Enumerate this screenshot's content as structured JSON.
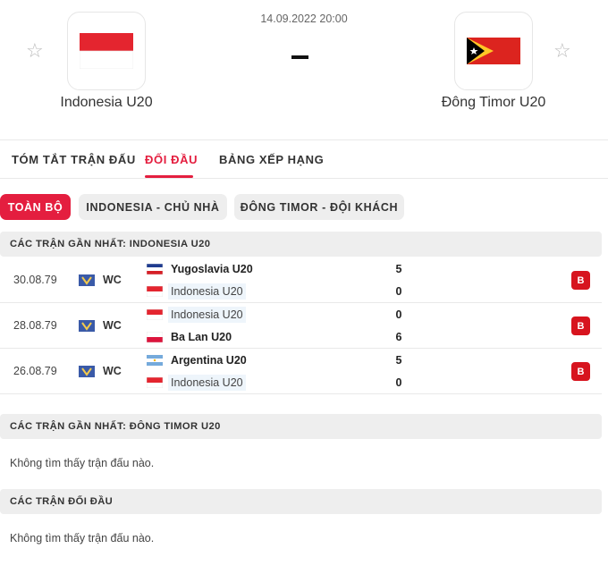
{
  "header": {
    "datetime": "14.09.2022 20:00",
    "home_team": {
      "name": "Indonesia U20",
      "flag": "indonesia-flag"
    },
    "away_team": {
      "name": "Đông Timor U20",
      "flag": "east-timor-flag"
    },
    "score_separator": "-"
  },
  "tabs": [
    {
      "label": "TÓM TẮT TRẬN ĐẤU",
      "active": false
    },
    {
      "label": "ĐỐI ĐẦU",
      "active": true
    },
    {
      "label": "BẢNG XẾP HẠNG",
      "active": false
    }
  ],
  "filters": [
    {
      "label": "TOÀN BỘ",
      "active": true
    },
    {
      "label": "INDONESIA - CHỦ NHÀ",
      "active": false
    },
    {
      "label": "ĐÔNG TIMOR - ĐỘI KHÁCH",
      "active": false
    }
  ],
  "sections": {
    "home_recent": {
      "title": "CÁC TRẬN GẦN NHẤT: INDONESIA U20",
      "matches": [
        {
          "date": "30.08.79",
          "competition": "WC",
          "team1": {
            "name": "Yugoslavia U20",
            "flag": "yugoslavia-flag",
            "score": "5"
          },
          "team2": {
            "name": "Indonesia U20",
            "flag": "indonesia-flag",
            "score": "0"
          },
          "result": "B"
        },
        {
          "date": "28.08.79",
          "competition": "WC",
          "team1": {
            "name": "Indonesia U20",
            "flag": "indonesia-flag",
            "score": "0"
          },
          "team2": {
            "name": "Ba Lan U20",
            "flag": "poland-flag",
            "score": "6"
          },
          "result": "B"
        },
        {
          "date": "26.08.79",
          "competition": "WC",
          "team1": {
            "name": "Argentina U20",
            "flag": "argentina-flag",
            "score": "5"
          },
          "team2": {
            "name": "Indonesia U20",
            "flag": "indonesia-flag",
            "score": "0"
          },
          "result": "B"
        }
      ]
    },
    "away_recent": {
      "title": "CÁC TRẬN GẦN NHẤT: ĐÔNG TIMOR U20",
      "empty_text": "Không tìm thấy trận đấu nào."
    },
    "head_to_head": {
      "title": "CÁC TRẬN ĐỐI ĐẦU",
      "empty_text": "Không tìm thấy trận đấu nào."
    }
  },
  "colors": {
    "accent": "#e41e3f",
    "loss_badge": "#d7141e",
    "section_bg": "#eeeeee",
    "highlight_bg": "#eef5fb"
  }
}
